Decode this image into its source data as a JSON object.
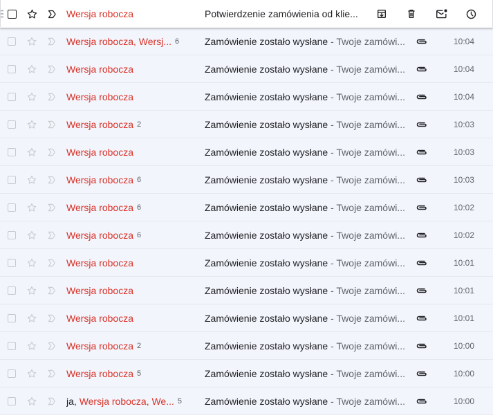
{
  "hover_actions": {
    "archive_icon": "archive-icon",
    "delete_icon": "trash-icon",
    "mark_unread_icon": "mark-unread-icon",
    "snooze_icon": "snooze-icon"
  },
  "colors": {
    "draft_red": "#d93025",
    "row_background": "#f2f5fc",
    "hover_background": "#ffffff",
    "secondary_text": "#5f6368"
  },
  "rows": [
    {
      "sender_me": "",
      "sender_drafts": "Wersja robocza",
      "sender_count": "",
      "subject": "Potwierdzenie zamówienia od klie...",
      "snippet": "",
      "time": "",
      "hovered": true
    },
    {
      "sender_me": "",
      "sender_drafts": "Wersja robocza, Wersj...",
      "sender_count": "6",
      "subject": "Zamówienie zostało wysłane",
      "snippet": " - Twoje zamówi...",
      "time": "10:04"
    },
    {
      "sender_me": "",
      "sender_drafts": "Wersja robocza",
      "sender_count": "",
      "subject": "Zamówienie zostało wysłane",
      "snippet": " - Twoje zamówi...",
      "time": "10:04"
    },
    {
      "sender_me": "",
      "sender_drafts": "Wersja robocza",
      "sender_count": "",
      "subject": "Zamówienie zostało wysłane",
      "snippet": " - Twoje zamówi...",
      "time": "10:04"
    },
    {
      "sender_me": "",
      "sender_drafts": "Wersja robocza",
      "sender_count": "2",
      "subject": "Zamówienie zostało wysłane",
      "snippet": " - Twoje zamówi...",
      "time": "10:03"
    },
    {
      "sender_me": "",
      "sender_drafts": "Wersja robocza",
      "sender_count": "",
      "subject": "Zamówienie zostało wysłane",
      "snippet": " - Twoje zamówi...",
      "time": "10:03"
    },
    {
      "sender_me": "",
      "sender_drafts": "Wersja robocza",
      "sender_count": "6",
      "subject": "Zamówienie zostało wysłane",
      "snippet": " - Twoje zamówi...",
      "time": "10:03"
    },
    {
      "sender_me": "",
      "sender_drafts": "Wersja robocza",
      "sender_count": "6",
      "subject": "Zamówienie zostało wysłane",
      "snippet": " - Twoje zamówi...",
      "time": "10:02"
    },
    {
      "sender_me": "",
      "sender_drafts": "Wersja robocza",
      "sender_count": "6",
      "subject": "Zamówienie zostało wysłane",
      "snippet": " - Twoje zamówi...",
      "time": "10:02"
    },
    {
      "sender_me": "",
      "sender_drafts": "Wersja robocza",
      "sender_count": "",
      "subject": "Zamówienie zostało wysłane",
      "snippet": " - Twoje zamówi...",
      "time": "10:01"
    },
    {
      "sender_me": "",
      "sender_drafts": "Wersja robocza",
      "sender_count": "",
      "subject": "Zamówienie zostało wysłane",
      "snippet": " - Twoje zamówi...",
      "time": "10:01"
    },
    {
      "sender_me": "",
      "sender_drafts": "Wersja robocza",
      "sender_count": "",
      "subject": "Zamówienie zostało wysłane",
      "snippet": " - Twoje zamówi...",
      "time": "10:01"
    },
    {
      "sender_me": "",
      "sender_drafts": "Wersja robocza",
      "sender_count": "2",
      "subject": "Zamówienie zostało wysłane",
      "snippet": " - Twoje zamówi...",
      "time": "10:00"
    },
    {
      "sender_me": "",
      "sender_drafts": "Wersja robocza",
      "sender_count": "5",
      "subject": "Zamówienie zostało wysłane",
      "snippet": " - Twoje zamówi...",
      "time": "10:00"
    },
    {
      "sender_me": "ja",
      "sender_drafts": "Wersja robocza, We...",
      "sender_count": "5",
      "subject": "Zamówienie zostało wysłane",
      "snippet": " - Twoje zamówi...",
      "time": "10:00"
    }
  ]
}
